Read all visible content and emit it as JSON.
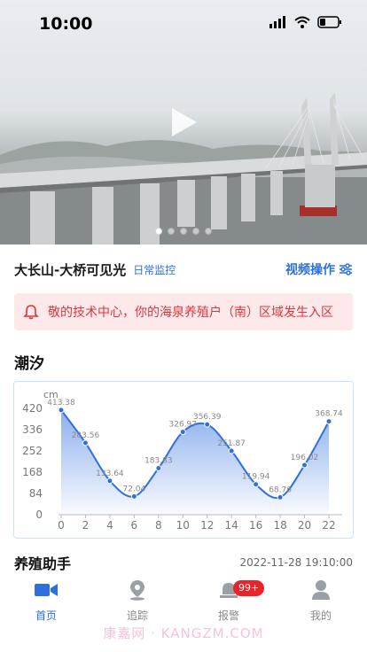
{
  "status_bar": {
    "time": "10:00"
  },
  "hero": {
    "dots": 5,
    "active_dot": 0
  },
  "location": {
    "name": "大长山-大桥可见光",
    "tag": "日常监控",
    "video_ops_label": "视频操作"
  },
  "alert": {
    "text": "敬的技术中心，你的海泉养殖户（南）区域发生入区"
  },
  "tide": {
    "title": "潮汐",
    "chart_data": {
      "type": "line",
      "title": "",
      "ylabel": "cm",
      "xlabel": "",
      "x": [
        0,
        2,
        4,
        6,
        8,
        10,
        12,
        14,
        16,
        18,
        20,
        22
      ],
      "xticks": [
        "0",
        "2",
        "4",
        "6",
        "8",
        "10",
        "12",
        "14",
        "16",
        "18",
        "20",
        "22"
      ],
      "yticks": [
        "420",
        "336",
        "252",
        "168",
        "84",
        "0"
      ],
      "ylim": [
        0,
        420
      ],
      "series": [
        {
          "values": [
            413.38,
            283.56,
            133.64,
            72.04,
            183.83,
            326.97,
            356.39,
            251.87,
            119.94,
            68.76,
            196.02,
            368.74
          ],
          "labels": [
            "413.38",
            "283.56",
            "133.64",
            "72.04",
            "183.83",
            "326.97",
            "356.39",
            "251.87",
            "119.94",
            "68.76",
            "196.02",
            "368.74"
          ]
        }
      ],
      "color": "#2f6fe0",
      "grid": false
    }
  },
  "assistant": {
    "title": "养殖助手",
    "timestamp": "2022-11-28 19:10:00"
  },
  "tabbar": {
    "tabs": [
      {
        "label": "首页",
        "icon": "video-camera-icon",
        "active": true
      },
      {
        "label": "追踪",
        "icon": "location-pin-icon",
        "active": false
      },
      {
        "label": "报警",
        "icon": "alarm-icon",
        "active": false,
        "badge": "99+"
      },
      {
        "label": "我的",
        "icon": "user-icon",
        "active": false
      }
    ]
  },
  "watermark": "康嘉网 · KANGZM.COM",
  "colors": {
    "accent": "#2b6fe0",
    "alert_bg": "#fde9ea",
    "alert_text": "#d9373f",
    "badge": "#e8232b"
  }
}
